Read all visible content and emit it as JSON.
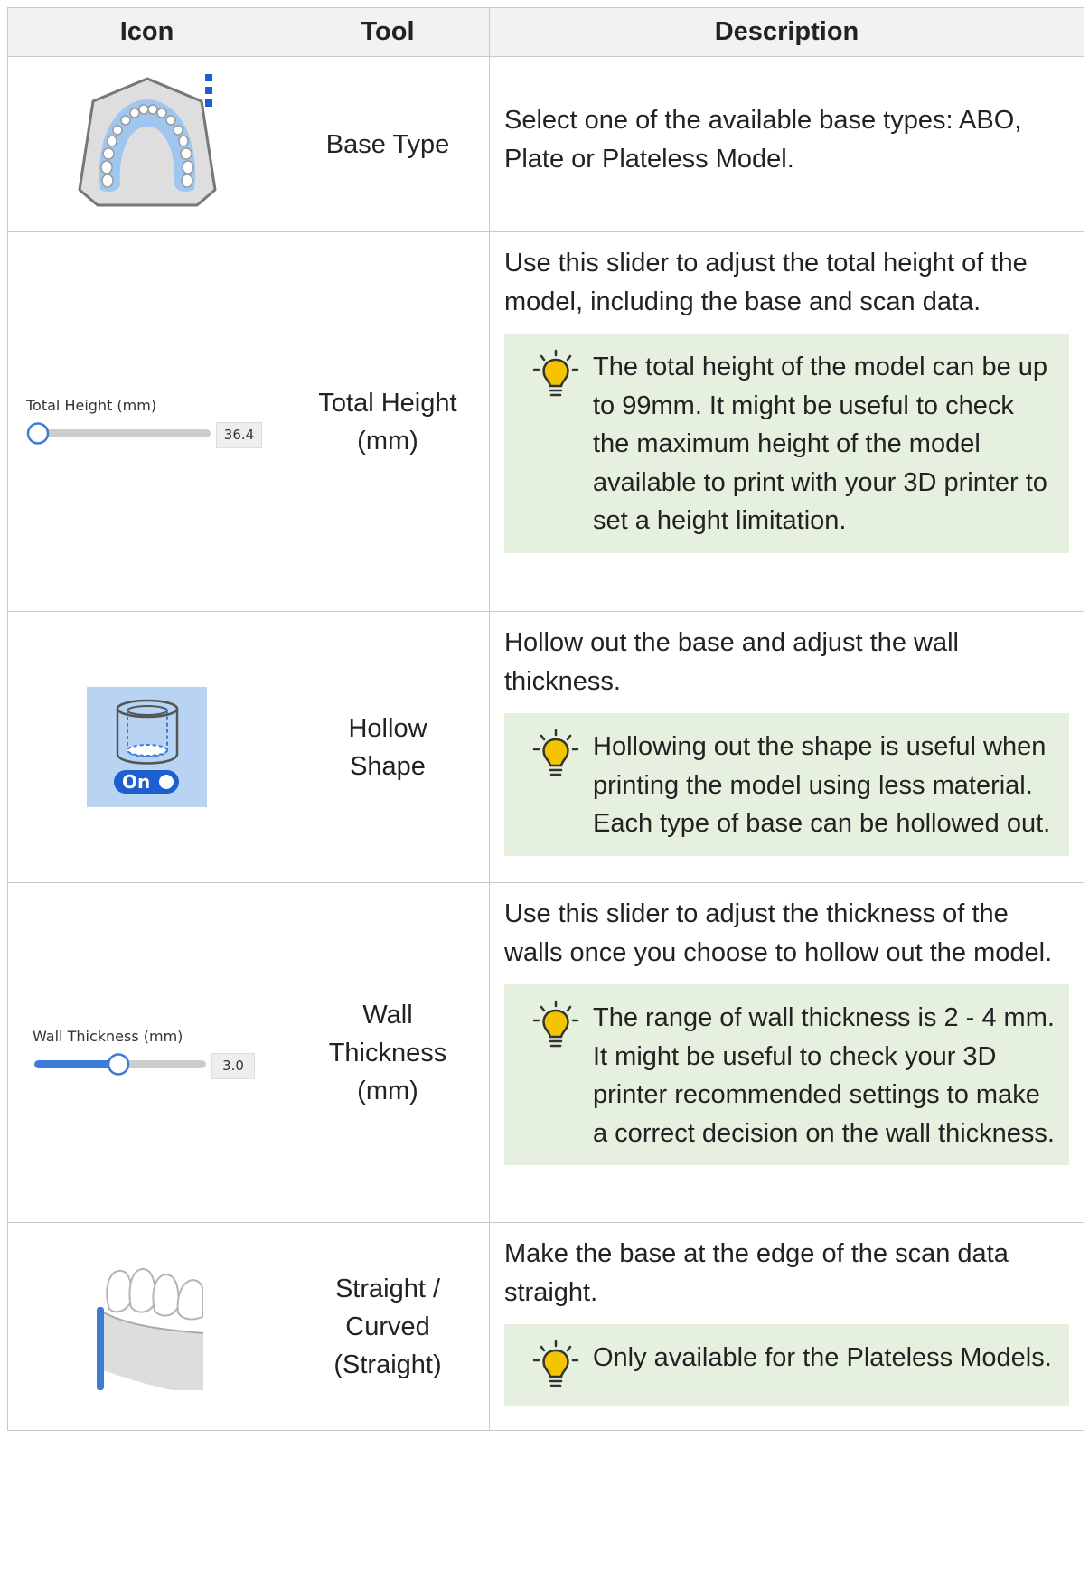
{
  "headers": {
    "icon": "Icon",
    "tool": "Tool",
    "description": "Description"
  },
  "rows": [
    {
      "tool": "Base Type",
      "description": "Select one of the available base types: ABO, Plate or Plateless Model.",
      "icon_name": "base-type-icon"
    },
    {
      "tool": "Total Height (mm)",
      "description": "Use this slider to adjust the total height of the model, including the base and scan data.",
      "tip": "The total height of the model can be up to 99mm. It might be useful to check the maximum height of the model available to print with your 3D printer to set a height limitation.",
      "icon_name": "total-height-slider-icon",
      "slider": {
        "label": "Total Height (mm)",
        "value": "36.4",
        "fill_fraction": 0.0
      }
    },
    {
      "tool": "Hollow Shape",
      "description": "Hollow out the base and adjust the wall thickness.",
      "tip": "Hollowing out the shape is useful when printing the model using less material. Each type of base can be hollowed out.",
      "icon_name": "hollow-shape-toggle-icon",
      "toggle": {
        "label": "On",
        "state": "on"
      }
    },
    {
      "tool": "Wall Thickness (mm)",
      "description": "Use this slider to adjust the thickness of the walls once you choose to hollow out the model.",
      "tip": "The range of wall thickness is 2 - 4 mm. It might be useful to check your 3D printer recommended settings to make a correct decision on the wall thickness.",
      "icon_name": "wall-thickness-slider-icon",
      "slider": {
        "label": "Wall Thickness (mm)",
        "value": "3.0",
        "fill_fraction": 0.5
      }
    },
    {
      "tool": "Straight / Curved (Straight)",
      "description": "Make the base at the edge of the scan data straight.",
      "tip": "Only available for the Plateless Models.",
      "icon_name": "straight-edge-icon"
    }
  ],
  "colors": {
    "header_bg": "#f2f2f2",
    "border": "#c9c9c9",
    "tip_bg": "#e6f0df",
    "bulb": "#f5c400",
    "accent_blue": "#3d7bd6",
    "toggle_bg": "#b8d4f2"
  }
}
